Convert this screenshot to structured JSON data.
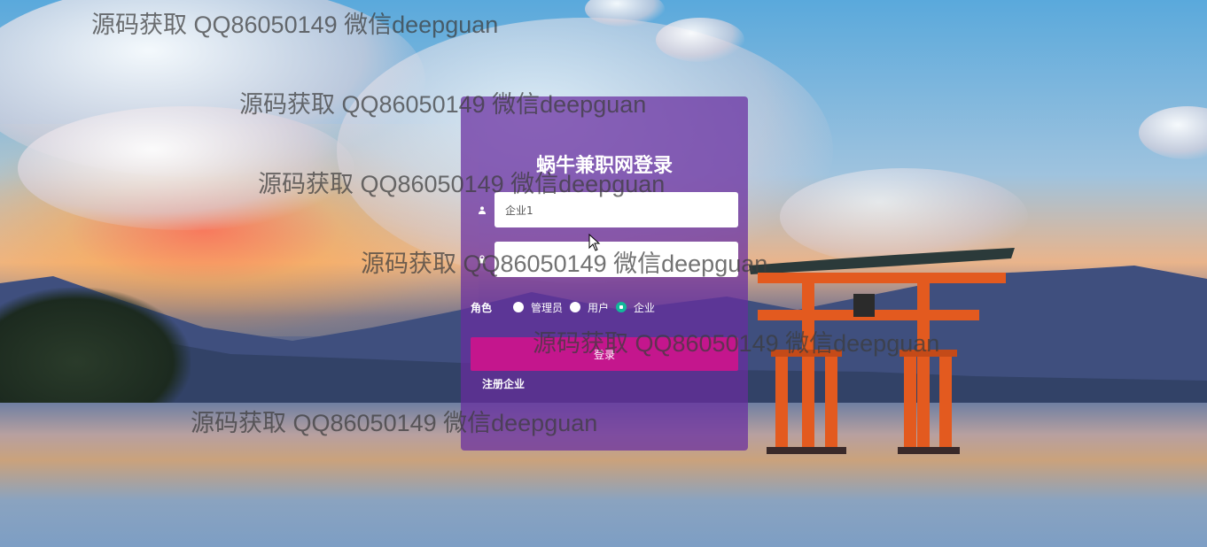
{
  "login": {
    "title": "蜗牛兼职网登录",
    "username_value": "企业1",
    "password_value": "",
    "role_label": "角色",
    "roles": [
      "管理员",
      "用户",
      "企业"
    ],
    "selected_role": "企业",
    "login_button": "登录",
    "register_link": "注册企业"
  },
  "watermarks": [
    "源码获取 QQ86050149 微信deepguan",
    "源码获取 QQ86050149 微信deepguan",
    "源码获取 QQ86050149 微信deepguan",
    "源码获取 QQ86050149 微信deepguan",
    "源码获取 QQ86050149 微信deepguan",
    "源码获取 QQ86050149 微信deepguan"
  ],
  "colors": {
    "panel": "#682ca0",
    "login_button": "#c4168d",
    "radio_checked": "#12b89a"
  },
  "icons": {
    "username": "user-icon",
    "password": "lock-icon"
  }
}
